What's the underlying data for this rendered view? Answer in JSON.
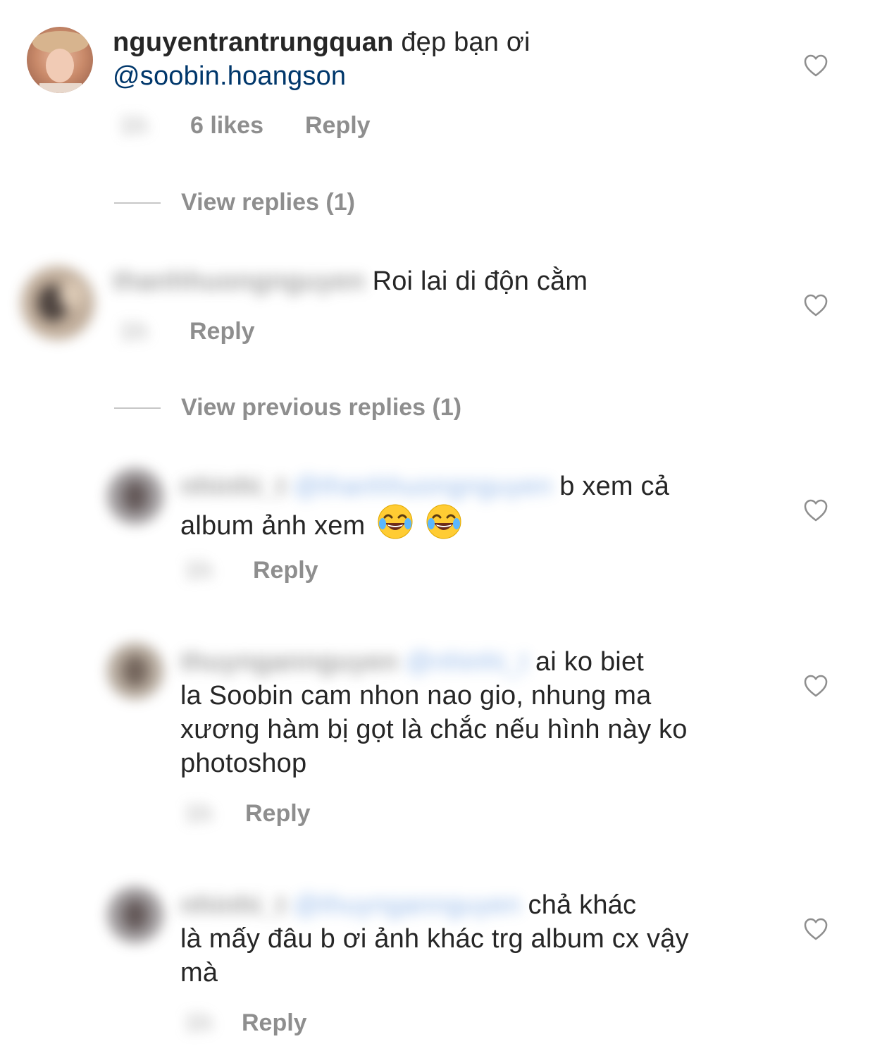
{
  "comments": [
    {
      "username": "nguyentrantrungquan",
      "text_line1": "đẹp bạn ơi",
      "mention": "@soobin.hoangson",
      "time": "1h",
      "likes": "6 likes",
      "reply_label": "Reply",
      "view_replies": "View replies (1)"
    },
    {
      "username_blurred": "thanhhuongnguyen",
      "text": "Roi lai di độn cằm",
      "time": "1h",
      "reply_label": "Reply",
      "view_previous": "View previous replies (1)"
    }
  ],
  "replies": [
    {
      "username_blurred": "nhinhi_t",
      "mention_blurred": "@thanhhuongnguyen",
      "line1": "b xem cả",
      "line2": "album ảnh xem",
      "emoji": "joy-emoji",
      "time": "1h",
      "reply_label": "Reply"
    },
    {
      "username_blurred": "thuyngannguyen",
      "mention_blurred": "@nhinhi_t",
      "line1": "ai ko biet",
      "line2": "la Soobin cam nhon nao gio, nhung ma",
      "line3": "xương hàm bị gọt là chắc nếu hình này ko",
      "line4": "photoshop",
      "time": "1h",
      "reply_label": "Reply"
    },
    {
      "username_blurred": "nhinhi_t",
      "mention_blurred": "@thuyngannguyen",
      "line1": "chả khác",
      "line2": "là mấy đâu b ơi ảnh khác trg album cx vậy",
      "line3": "mà",
      "time": "1h",
      "reply_label": "Reply"
    }
  ],
  "icons": {
    "like": "heart-outline-icon"
  },
  "colors": {
    "mention": "#00376b",
    "meta": "#8e8e8e",
    "text": "#262626"
  }
}
